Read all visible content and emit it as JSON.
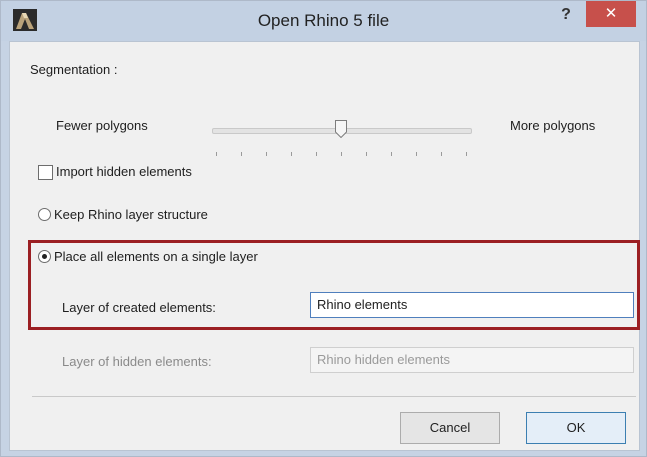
{
  "window": {
    "title": "Open Rhino 5 file",
    "help_label": "?",
    "close_label": "✕",
    "app_icon": "rhino-app-icon"
  },
  "segmentation": {
    "label": "Segmentation :",
    "min_label": "Fewer polygons",
    "max_label": "More polygons",
    "slider_value": 0.5,
    "tick_count": 11
  },
  "options": {
    "import_hidden_label": "Import hidden elements",
    "import_hidden_checked": false,
    "keep_layer_label": "Keep Rhino layer structure",
    "single_layer_label": "Place all elements on a single layer",
    "selected_option": "single_layer"
  },
  "layers": {
    "created_label": "Layer of created elements:",
    "created_value": "Rhino elements",
    "hidden_label": "Layer of hidden elements:",
    "hidden_value": "Rhino hidden elements"
  },
  "buttons": {
    "cancel_label": "Cancel",
    "ok_label": "OK"
  },
  "colors": {
    "highlight_border": "#9b1f23",
    "close_button": "#c7504b"
  }
}
